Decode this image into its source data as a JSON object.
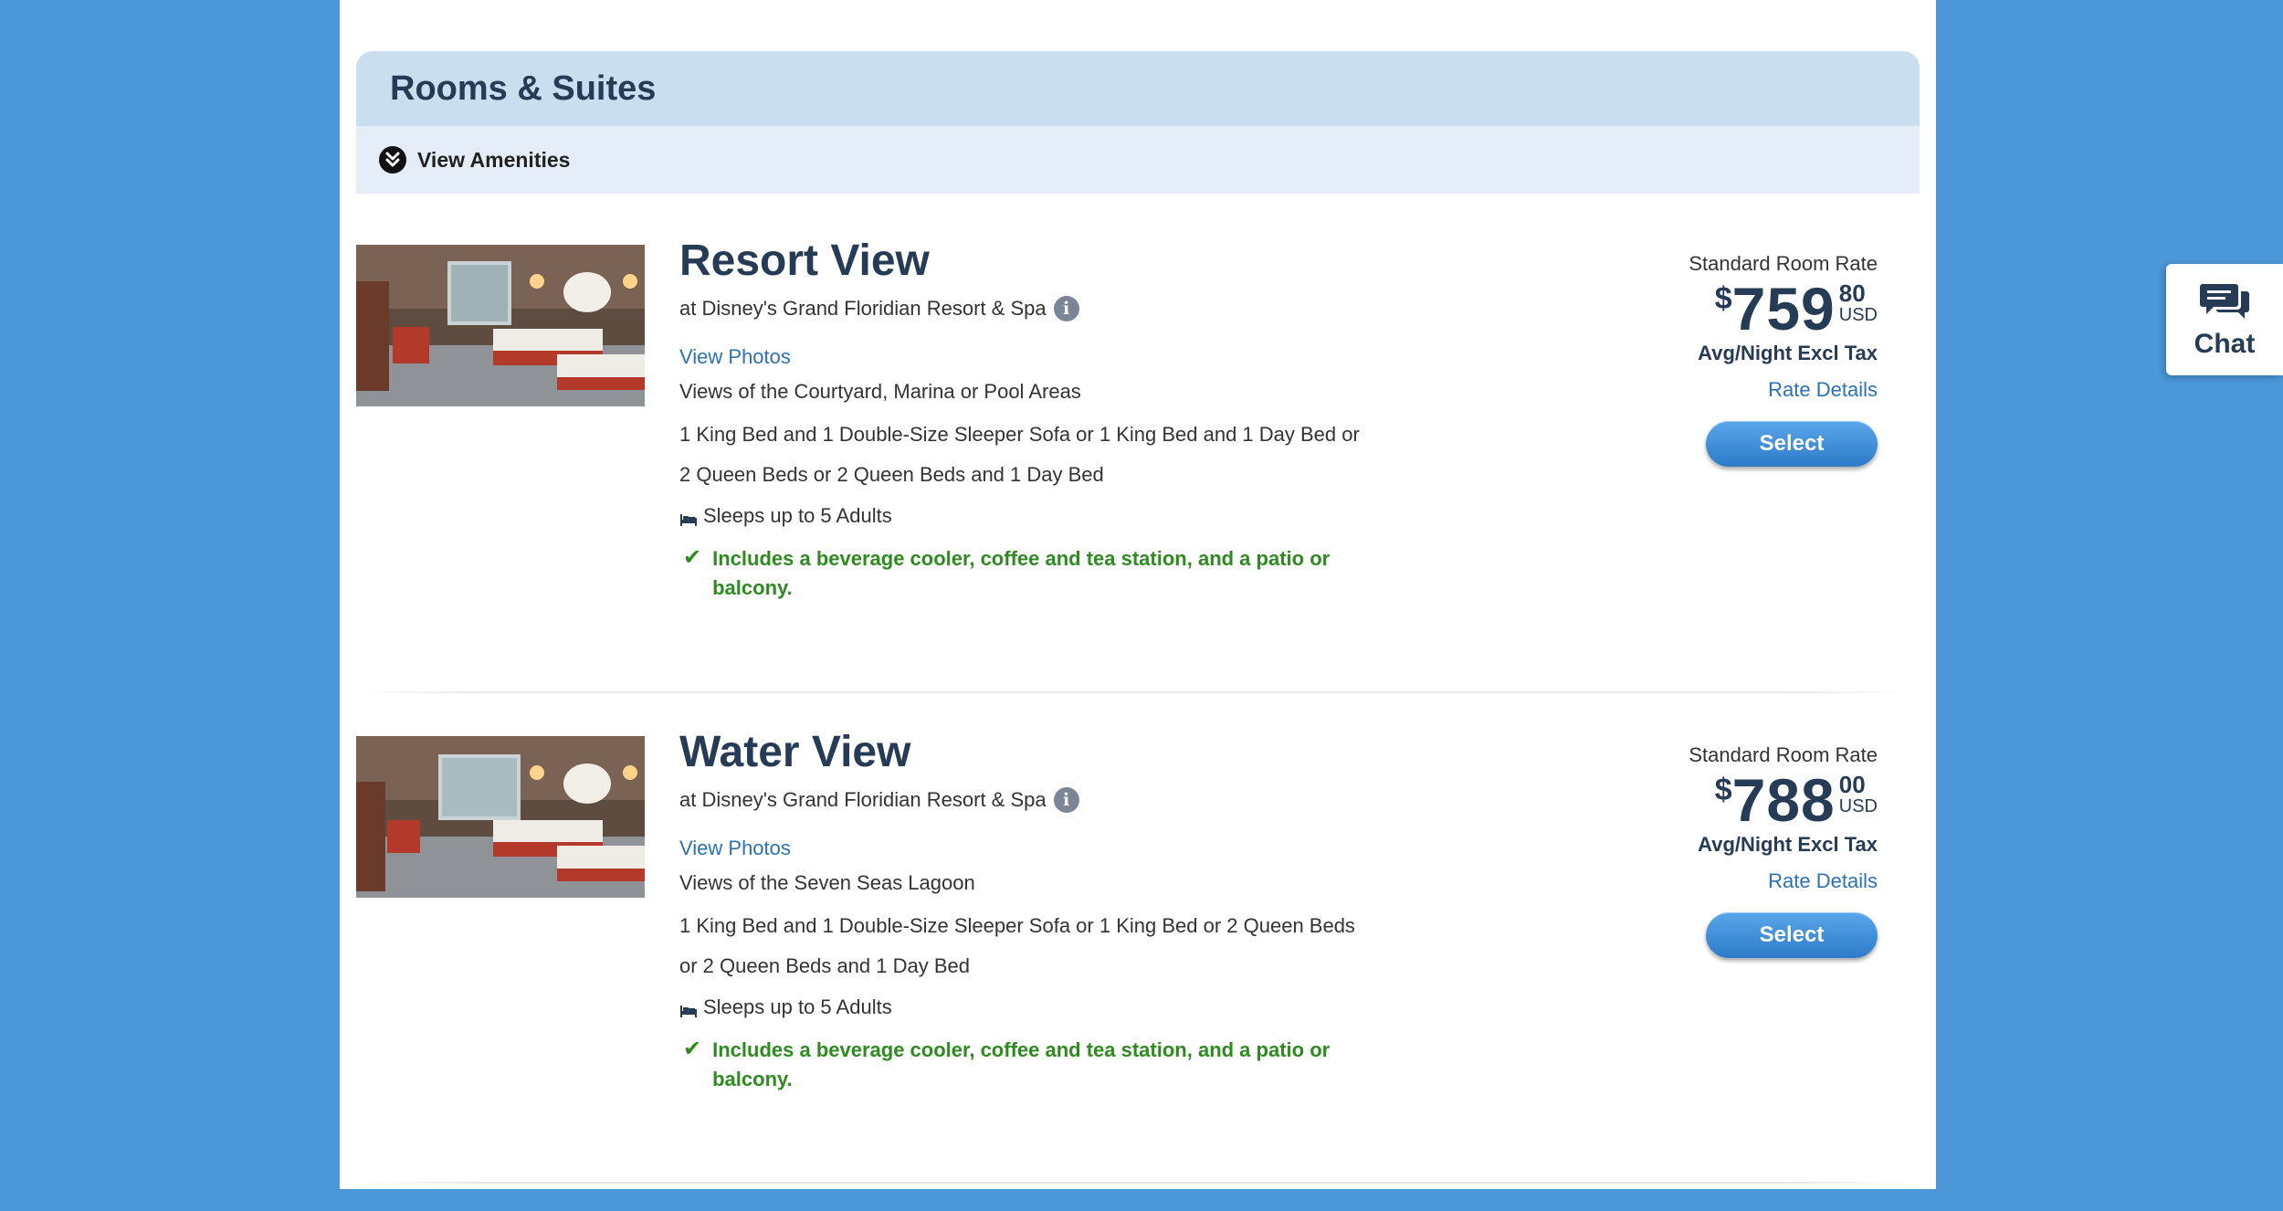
{
  "section": {
    "title": "Rooms & Suites",
    "amenities_label": "View Amenities",
    "amenities_icon": "double-chevron-down-icon"
  },
  "rooms": [
    {
      "name": "Resort View",
      "location": "at Disney's Grand Floridian Resort & Spa",
      "view_photos": "View Photos",
      "view": "Views of the Courtyard, Marina or Pool Areas",
      "beds": "1 King Bed and 1 Double-Size Sleeper Sofa or 1 King Bed and 1 Day Bed or 2 Queen Beds or 2 Queen Beds and 1 Day Bed",
      "sleeps": "Sleeps up to 5 Adults",
      "includes": "Includes a beverage cooler, coffee and tea station, and a patio or balcony.",
      "rate_label": "Standard Room Rate",
      "price_symbol": "$",
      "price_dollars": "759",
      "price_cents": "80",
      "currency": "USD",
      "per_night": "Avg/Night Excl Tax",
      "rate_details": "Rate Details",
      "select_label": "Select"
    },
    {
      "name": "Water View",
      "location": "at Disney's Grand Floridian Resort & Spa",
      "view_photos": "View Photos",
      "view": "Views of the Seven Seas Lagoon",
      "beds": "1 King Bed and 1 Double-Size Sleeper Sofa or 1 King Bed or 2 Queen Beds or 2 Queen Beds and 1 Day Bed",
      "sleeps": "Sleeps up to 5 Adults",
      "includes": "Includes a beverage cooler, coffee and tea station, and a patio or balcony.",
      "rate_label": "Standard Room Rate",
      "price_symbol": "$",
      "price_dollars": "788",
      "price_cents": "00",
      "currency": "USD",
      "per_night": "Avg/Night Excl Tax",
      "rate_details": "Rate Details",
      "select_label": "Select"
    }
  ],
  "chat": {
    "label": "Chat",
    "icon": "chat-bubbles-icon"
  },
  "colors": {
    "background": "#4b97d8",
    "heading": "#253b56",
    "link": "#2a72b5",
    "success": "#2e8b1f",
    "header_bar": "#c9deef",
    "amenities_bar": "#e5eef8"
  }
}
